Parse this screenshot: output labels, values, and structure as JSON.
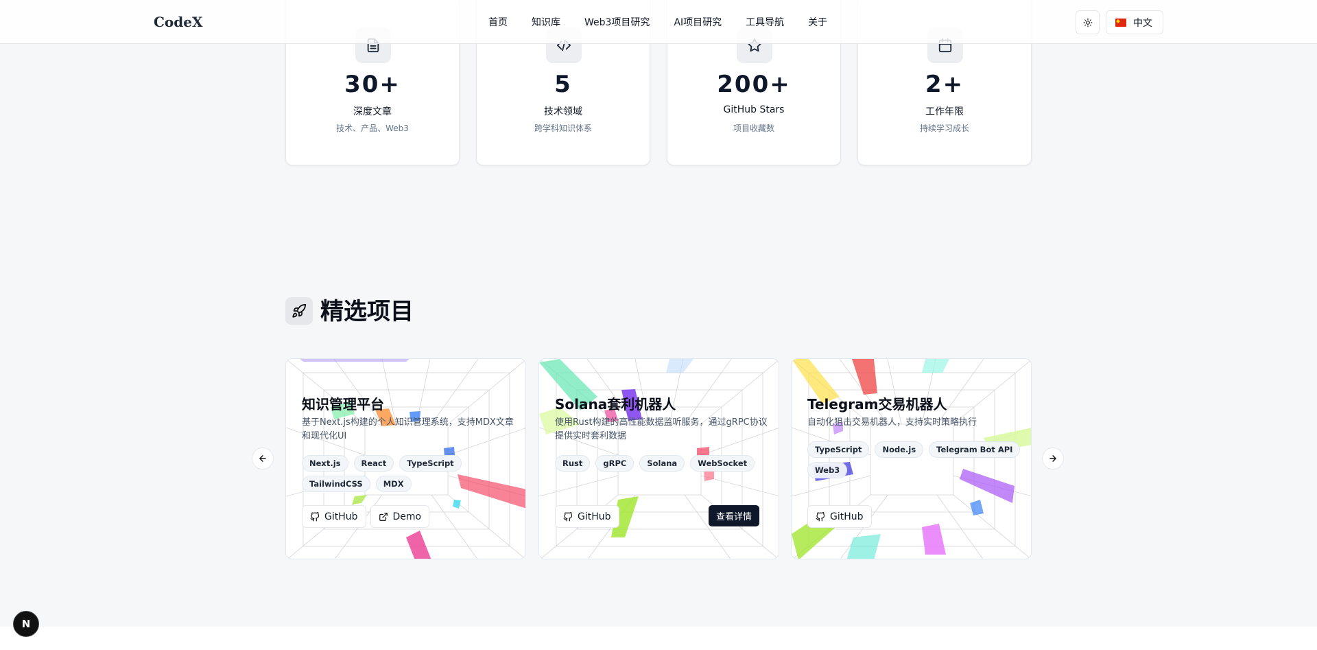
{
  "header": {
    "logo": "CodeX",
    "nav": [
      "首页",
      "知识库",
      "Web3项目研究",
      "AI项目研究",
      "工具导航",
      "关于"
    ],
    "language": "中文",
    "theme_icon": "sun-icon"
  },
  "stats": [
    {
      "icon": "document-icon",
      "value": "30+",
      "label": "深度文章",
      "sub": "技术、产品、Web3"
    },
    {
      "icon": "code-icon",
      "value": "5",
      "label": "技术领域",
      "sub": "跨学科知识体系"
    },
    {
      "icon": "star-icon",
      "value": "200+",
      "label": "GitHub Stars",
      "sub": "项目收藏数"
    },
    {
      "icon": "calendar-icon",
      "value": "2+",
      "label": "工作年限",
      "sub": "持续学习成长"
    }
  ],
  "projects_section": {
    "title": "精选项目",
    "icon": "rocket-icon"
  },
  "projects": [
    {
      "title": "知识管理平台",
      "desc": "基于Next.js构建的个人知识管理系统，支持MDX文章和现代化UI",
      "tags": [
        "Next.js",
        "React",
        "TypeScript",
        "TailwindCSS",
        "MDX"
      ],
      "github": "GitHub",
      "demo": "Demo"
    },
    {
      "title": "Solana套利机器人",
      "desc": "使用Rust构建的高性能数据监听服务，通过gRPC协议提供实时套利数据",
      "tags": [
        "Rust",
        "gRPC",
        "Solana",
        "WebSocket"
      ],
      "github": "GitHub",
      "detail": "查看详情"
    },
    {
      "title": "Telegram交易机器人",
      "desc": "自动化狙击交易机器人，支持实时策略执行",
      "tags": [
        "TypeScript",
        "Node.js",
        "Telegram Bot API",
        "Web3"
      ],
      "github": "GitHub"
    }
  ],
  "badge": "N"
}
